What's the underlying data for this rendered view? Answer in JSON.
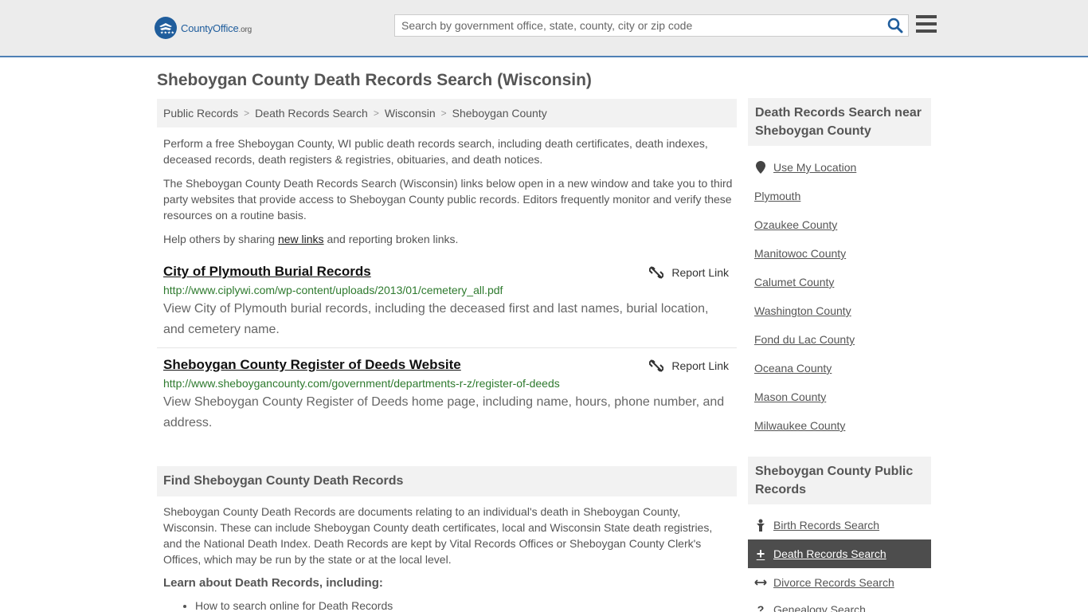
{
  "header": {
    "logo_name": "CountyOffice",
    "logo_tld": ".org",
    "search_placeholder": "Search by government office, state, county, city or zip code"
  },
  "page_title": "Sheboygan County Death Records Search (Wisconsin)",
  "breadcrumb": [
    "Public Records",
    "Death Records Search",
    "Wisconsin",
    "Sheboygan County"
  ],
  "intro": {
    "p1": "Perform a free Sheboygan County, WI public death records search, including death certificates, death indexes, deceased records, death registers & registries, obituaries, and death notices.",
    "p2": "The Sheboygan County Death Records Search (Wisconsin) links below open in a new window and take you to third party websites that provide access to Sheboygan County public records. Editors frequently monitor and verify these resources on a routine basis.",
    "p3_before": "Help others by sharing ",
    "p3_link": "new links",
    "p3_after": " and reporting broken links."
  },
  "results": [
    {
      "title": "City of Plymouth Burial Records",
      "url": "http://www.ciplywi.com/wp-content/uploads/2013/01/cemetery_all.pdf",
      "desc": "View City of Plymouth burial records, including the deceased first and last names, burial location, and cemetery name.",
      "report": "Report Link"
    },
    {
      "title": "Sheboygan County Register of Deeds Website",
      "url": "http://www.sheboygancounty.com/government/departments-r-z/register-of-deeds",
      "desc": "View Sheboygan County Register of Deeds home page, including name, hours, phone number, and address.",
      "report": "Report Link"
    }
  ],
  "find_section": {
    "heading": "Find Sheboygan County Death Records",
    "body": "Sheboygan County Death Records are documents relating to an individual's death in Sheboygan County, Wisconsin. These can include Sheboygan County death certificates, local and Wisconsin State death registries, and the National Death Index. Death Records are kept by Vital Records Offices or Sheboygan County Clerk's Offices, which may be run by the state or at the local level.",
    "learn_heading": "Learn about Death Records, including:",
    "learn_items": [
      "How to search online for Death Records"
    ]
  },
  "sidebar": {
    "near_heading": "Death Records Search near Sheboygan County",
    "use_location": "Use My Location",
    "near_links": [
      "Plymouth",
      "Ozaukee County",
      "Manitowoc County",
      "Calumet County",
      "Washington County",
      "Fond du Lac County",
      "Oceana County",
      "Mason County",
      "Milwaukee County"
    ],
    "public_heading": "Sheboygan County Public Records",
    "public_links": [
      "Birth Records Search",
      "Death Records Search",
      "Divorce Records Search",
      "Genealogy Search"
    ]
  }
}
